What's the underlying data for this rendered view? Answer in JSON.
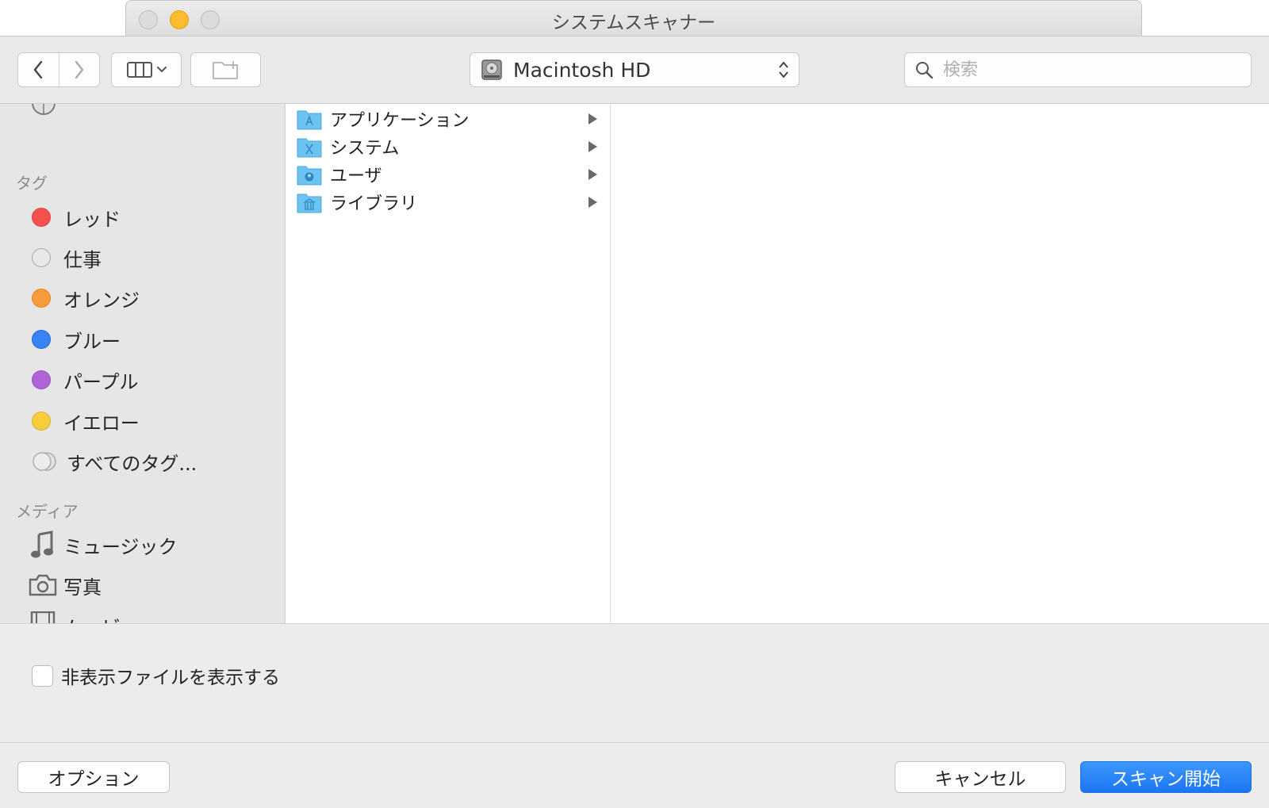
{
  "background_window": {
    "title": "システムスキャナー"
  },
  "toolbar": {
    "location": "Macintosh HD",
    "search_placeholder": "検索"
  },
  "sidebar": {
    "tags_header": "タグ",
    "tags": [
      {
        "label": "レッド",
        "color": "#f5514f",
        "border": "#d8403e"
      },
      {
        "label": "仕事",
        "color": "#e7e7e7",
        "border": "#a9a9a9"
      },
      {
        "label": "オレンジ",
        "color": "#f89c3b",
        "border": "#dc8426"
      },
      {
        "label": "ブルー",
        "color": "#3884f6",
        "border": "#2566d6"
      },
      {
        "label": "パープル",
        "color": "#b065d6",
        "border": "#9550ba"
      },
      {
        "label": "イエロー",
        "color": "#f8cd3e",
        "border": "#dbb12a"
      }
    ],
    "all_tags": "すべてのタグ...",
    "media_header": "メディア",
    "media": [
      {
        "label": "ミュージック",
        "icon": "music-note-icon"
      },
      {
        "label": "写真",
        "icon": "camera-icon"
      },
      {
        "label": "ムービー",
        "icon": "film-icon"
      }
    ]
  },
  "browser": {
    "items": [
      {
        "label": "アプリケーション",
        "icon": "applications-folder-icon"
      },
      {
        "label": "システム",
        "icon": "system-folder-icon"
      },
      {
        "label": "ユーザ",
        "icon": "users-folder-icon"
      },
      {
        "label": "ライブラリ",
        "icon": "library-folder-icon"
      }
    ]
  },
  "options": {
    "show_hidden_label": "非表示ファイルを表示する",
    "show_hidden_checked": false
  },
  "footer": {
    "options_label": "オプション",
    "cancel_label": "キャンセル",
    "scan_label": "スキャン開始"
  },
  "colors": {
    "accent": "#1b76f2",
    "folder": "#6cc3f0"
  }
}
